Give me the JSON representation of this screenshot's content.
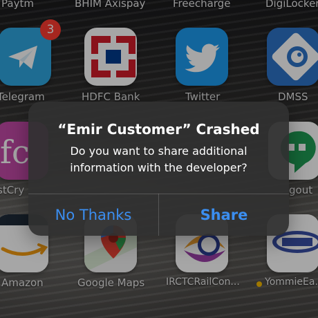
{
  "top_row_labels": [
    "Paytm",
    "BHIM Axispay",
    "Freecharge",
    "DigiLocker"
  ],
  "row2": {
    "labels": [
      "Telegram",
      "HDFC Bank",
      "Twitter",
      "DMSS"
    ],
    "telegram_badge": "3"
  },
  "row3": {
    "labels_partial": [
      "stCry",
      "gout"
    ]
  },
  "row4": {
    "labels": [
      "Amazon",
      "Google Maps",
      "IRCTCRailCon...",
      "YommieEa..."
    ]
  },
  "alert": {
    "title": "“Emir Customer” Crashed",
    "message_line1": "Do you want to share additional",
    "message_line2": "information with the developer?",
    "no_thanks": "No Thanks",
    "share": "Share"
  },
  "colors": {
    "ios_blue": "#3b8ef0",
    "badge_red": "#ff3b30",
    "telegram": "#2ea6e0",
    "twitter": "#1d9bf0",
    "hdfc_red": "#d31d2a",
    "hdfc_blue": "#003b8e"
  },
  "icons": {
    "telegram": "paper-plane-icon",
    "hdfc": "hdfc-logo-icon",
    "twitter": "bird-icon",
    "dmss": "camera-eye-icon",
    "amazon": "amazon-smile-icon",
    "google_maps": "map-pin-icon",
    "irctc": "train-logo-icon",
    "yommie": "yommie-logo-icon",
    "hangouts": "quote-bubble-icon"
  }
}
